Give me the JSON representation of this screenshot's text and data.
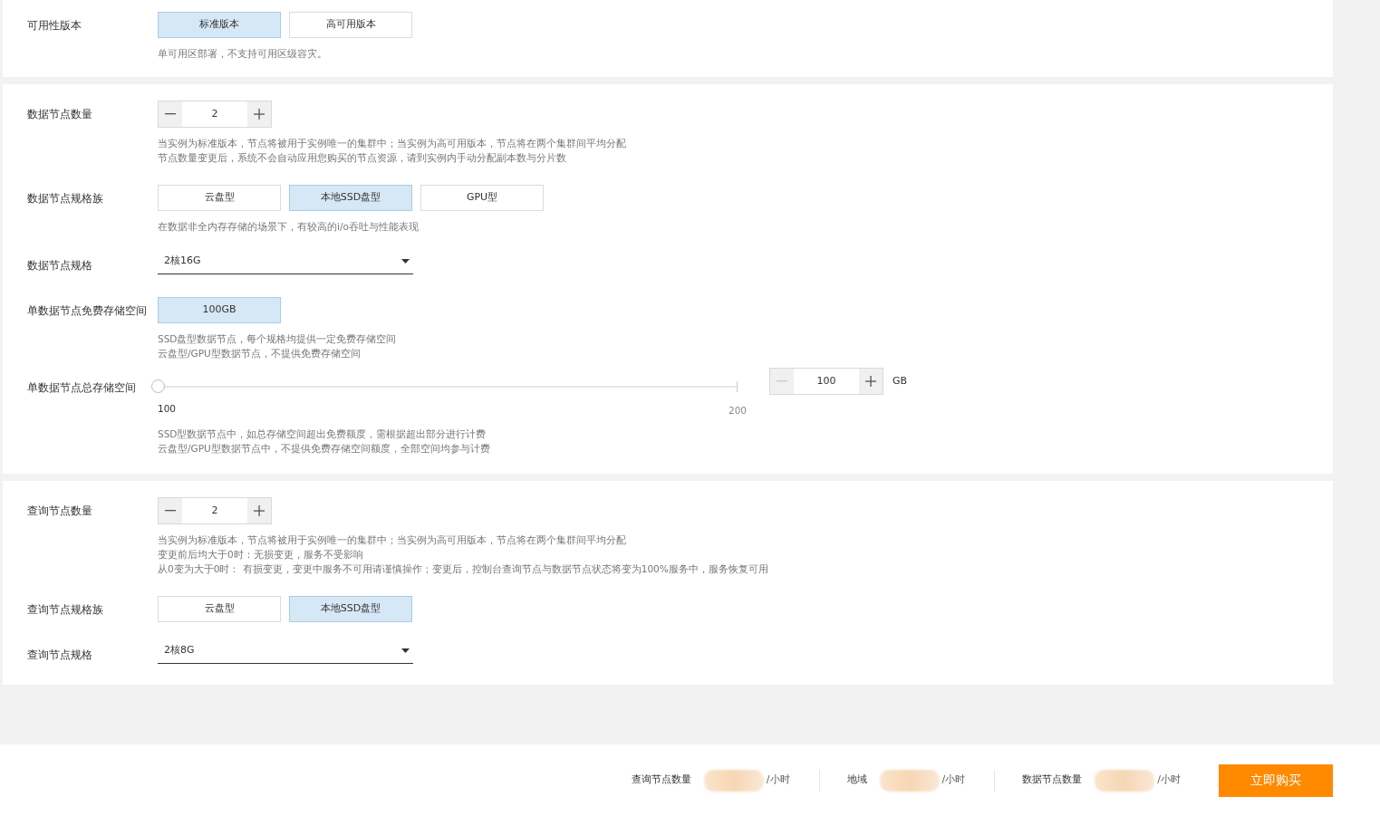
{
  "sections": [
    {
      "fields": [
        {
          "kind": "options",
          "label": "可用性版本",
          "options": [
            {
              "label": "标准版本",
              "selected": true
            },
            {
              "label": "高可用版本",
              "selected": false
            }
          ],
          "hints": [
            "单可用区部署，不支持可用区级容灾。"
          ]
        }
      ]
    },
    {
      "fields": [
        {
          "kind": "stepper",
          "label": "数据节点数量",
          "value": "2",
          "minus_disabled": false,
          "hints": [
            "当实例为标准版本，节点将被用于实例唯一的集群中；当实例为高可用版本，节点将在两个集群间平均分配",
            "节点数量变更后，系统不会自动应用您购买的节点资源，请到实例内手动分配副本数与分片数"
          ]
        },
        {
          "kind": "options",
          "label": "数据节点规格族",
          "options": [
            {
              "label": "云盘型",
              "selected": false
            },
            {
              "label": "本地SSD盘型",
              "selected": true
            },
            {
              "label": "GPU型",
              "selected": false
            }
          ],
          "hints": [
            "在数据非全内存存储的场景下，有较高的i/o吞吐与性能表现"
          ]
        },
        {
          "kind": "select",
          "label": "数据节点规格",
          "value": "2核16G"
        },
        {
          "kind": "options",
          "label": "单数据节点免费存储空间",
          "options": [
            {
              "label": "100GB",
              "selected": true
            }
          ],
          "hints": [
            "SSD盘型数据节点，每个规格均提供一定免费存储空间",
            "云盘型/GPU型数据节点，不提供免费存储空间"
          ]
        },
        {
          "kind": "slider",
          "label": "单数据节点总存储空间",
          "level": 0,
          "min_label": "100",
          "max_label": "200",
          "value": "100",
          "minus_disabled": true,
          "unit": "GB",
          "hints": [
            "SSD型数据节点中，如总存储空间超出免费额度，需根据超出部分进行计费",
            "云盘型/GPU型数据节点中，不提供免费存储空间额度，全部空间均参与计费"
          ]
        }
      ]
    },
    {
      "fields": [
        {
          "kind": "stepper",
          "label": "查询节点数量",
          "value": "2",
          "minus_disabled": false,
          "hints": [
            "当实例为标准版本，节点将被用于实例唯一的集群中；当实例为高可用版本，节点将在两个集群间平均分配",
            "变更前后均大于0时：无损变更，服务不受影响",
            "从0变为大于0时： 有损变更，变更中服务不可用请谨慎操作；变更后，控制台查询节点与数据节点状态将变为100%服务中，服务恢复可用"
          ]
        },
        {
          "kind": "options",
          "label": "查询节点规格族",
          "options": [
            {
              "label": "云盘型",
              "selected": false
            },
            {
              "label": "本地SSD盘型",
              "selected": true
            }
          ]
        },
        {
          "kind": "select",
          "label": "查询节点规格",
          "value": "2核8G"
        }
      ]
    }
  ],
  "footer": {
    "prices": [
      {
        "label": "查询节点数量",
        "unit": "/小时"
      },
      {
        "label": "地域",
        "unit": "/小时"
      },
      {
        "label": "数据节点数量",
        "unit": "/小时"
      }
    ],
    "buy_button": "立即购买"
  }
}
